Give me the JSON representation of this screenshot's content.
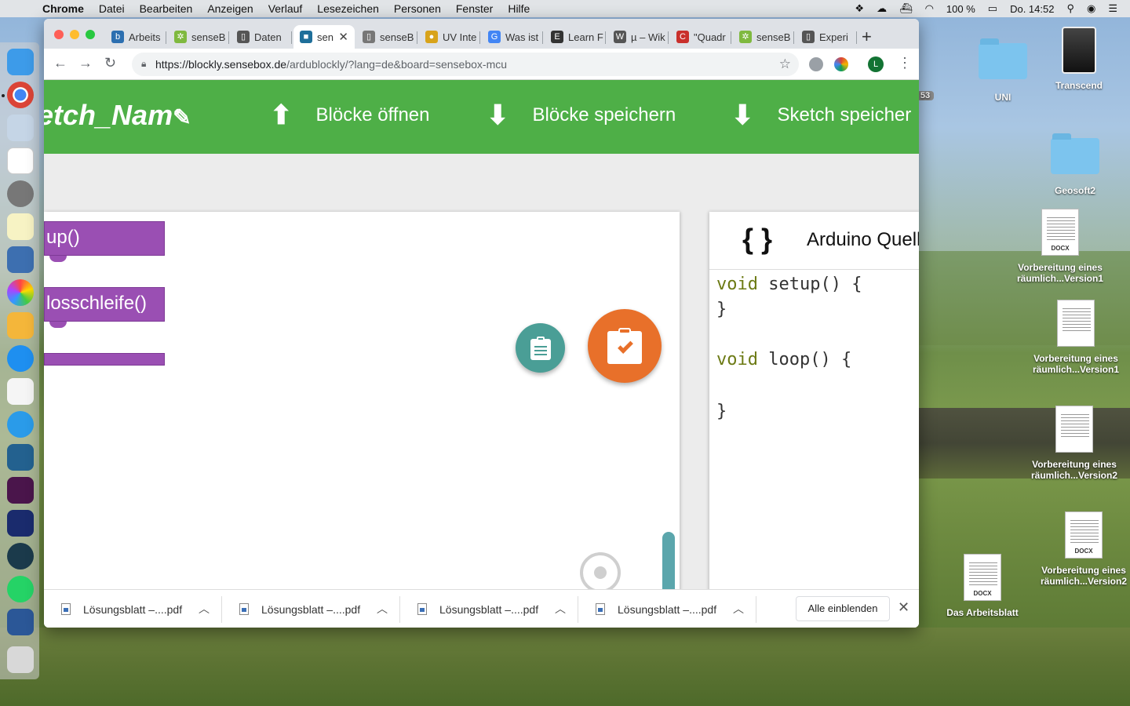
{
  "menubar": {
    "app": "Chrome",
    "items": [
      "Datei",
      "Bearbeiten",
      "Anzeigen",
      "Verlauf",
      "Lesezeichen",
      "Personen",
      "Fenster",
      "Hilfe"
    ],
    "battery": "100 %",
    "clock": "Do. 14:52"
  },
  "browser": {
    "tabs": [
      {
        "label": "Arbeits",
        "fav_color": "#2c6fb0",
        "fav_glyph": "b"
      },
      {
        "label": "senseB",
        "fav_color": "#7fb93f",
        "fav_glyph": "✲"
      },
      {
        "label": "Daten",
        "fav_color": "#555555",
        "fav_glyph": "▯"
      },
      {
        "label": "sen",
        "fav_color": "#1f6f9a",
        "fav_glyph": "■",
        "active": true
      },
      {
        "label": "senseB",
        "fav_color": "#777777",
        "fav_glyph": "▯"
      },
      {
        "label": "UV Inte",
        "fav_color": "#d8a31a",
        "fav_glyph": "●"
      },
      {
        "label": "Was ist",
        "fav_color": "#4285f4",
        "fav_glyph": "G"
      },
      {
        "label": "Learn F",
        "fav_color": "#333333",
        "fav_glyph": "E"
      },
      {
        "label": "µ – Wik",
        "fav_color": "#555555",
        "fav_glyph": "W"
      },
      {
        "label": "\"Quadr",
        "fav_color": "#c9302c",
        "fav_glyph": "C"
      },
      {
        "label": "senseB",
        "fav_color": "#7fb93f",
        "fav_glyph": "✲"
      },
      {
        "label": "Experi",
        "fav_color": "#555555",
        "fav_glyph": "▯"
      }
    ],
    "url_host": "https://blockly.sensebox.de",
    "url_path": "/ardublockly/?lang=de&board=sensebox-mcu",
    "profile_initial": "L"
  },
  "app": {
    "sketch_name": "etch_Nam",
    "open_blocks": "Blöcke öffnen",
    "save_blocks": "Blöcke speichern",
    "save_sketch": "Sketch speicher",
    "blocks": [
      {
        "label": "up()"
      },
      {
        "label": "losschleife()"
      },
      {
        "label": ""
      }
    ],
    "code_panel_title": "Arduino Quell",
    "code_panel_icon": "{ }",
    "code": {
      "l1_kw": "void",
      "l1_rest": " setup() {",
      "l2": "}",
      "l3_kw": "void",
      "l3_rest": " loop() {",
      "l4": "}"
    }
  },
  "downloads": {
    "items": [
      "Lösungsblatt –....pdf",
      "Lösungsblatt –....pdf",
      "Lösungsblatt –....pdf",
      "Lösungsblatt –....pdf"
    ],
    "show_all": "Alle einblenden"
  },
  "desktop": {
    "uni": "UNI",
    "transcend": "Transcend",
    "geosoft": "Geosoft2",
    "doc1": "Vorbereitung eines räumlich...Version1",
    "doc2": "Vorbereitung eines räumlich...Version1",
    "doc3": "Vorbereitung eines räumlich...Version2",
    "doc4": "Vorbereitung eines räumlich...Version2",
    "doc5": "Das Arbeitsblatt",
    "docx_label": "DOCX",
    "badge": "53"
  }
}
